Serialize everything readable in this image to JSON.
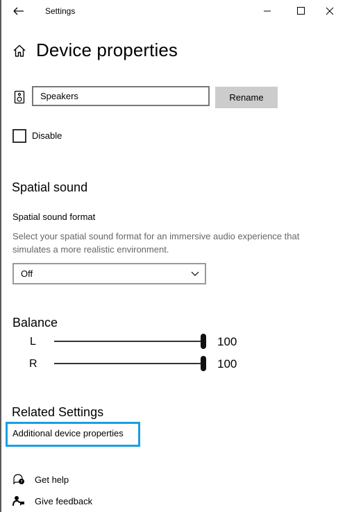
{
  "window": {
    "title": "Settings"
  },
  "page": {
    "title": "Device properties"
  },
  "device": {
    "name_value": "Speakers",
    "rename_label": "Rename",
    "disable_label": "Disable",
    "disable_checked": false
  },
  "spatial": {
    "heading": "Spatial sound",
    "format_label": "Spatial sound format",
    "description": "Select your spatial sound format for an immersive audio experience that simulates a more realistic environment.",
    "selected": "Off"
  },
  "balance": {
    "heading": "Balance",
    "left_label": "L",
    "left_value": "100",
    "right_label": "R",
    "right_value": "100"
  },
  "related": {
    "heading": "Related Settings",
    "link": "Additional device properties"
  },
  "footer": {
    "help": "Get help",
    "feedback": "Give feedback"
  },
  "colors": {
    "accent": "#1a9ee2",
    "button": "#cccccc"
  },
  "icons": [
    "back-arrow-icon",
    "minimize-icon",
    "maximize-icon",
    "close-icon",
    "home-icon",
    "speaker-icon",
    "chevron-down-icon",
    "help-icon",
    "feedback-icon"
  ]
}
